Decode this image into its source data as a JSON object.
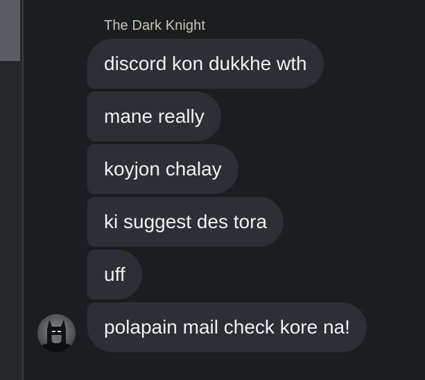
{
  "conversation": {
    "sender_name": "The Dark Knight",
    "messages": [
      "discord kon dukkhe wth",
      "mane really",
      "koyjon chalay",
      "ki suggest des tora",
      "uff",
      "polapain mail check kore na!"
    ],
    "avatar_icon": "batman-avatar-icon"
  },
  "colors": {
    "background": "#1c1d1f",
    "bubble": "#2c2f33",
    "text": "#f1f1f1",
    "name": "#c9c6bd"
  }
}
